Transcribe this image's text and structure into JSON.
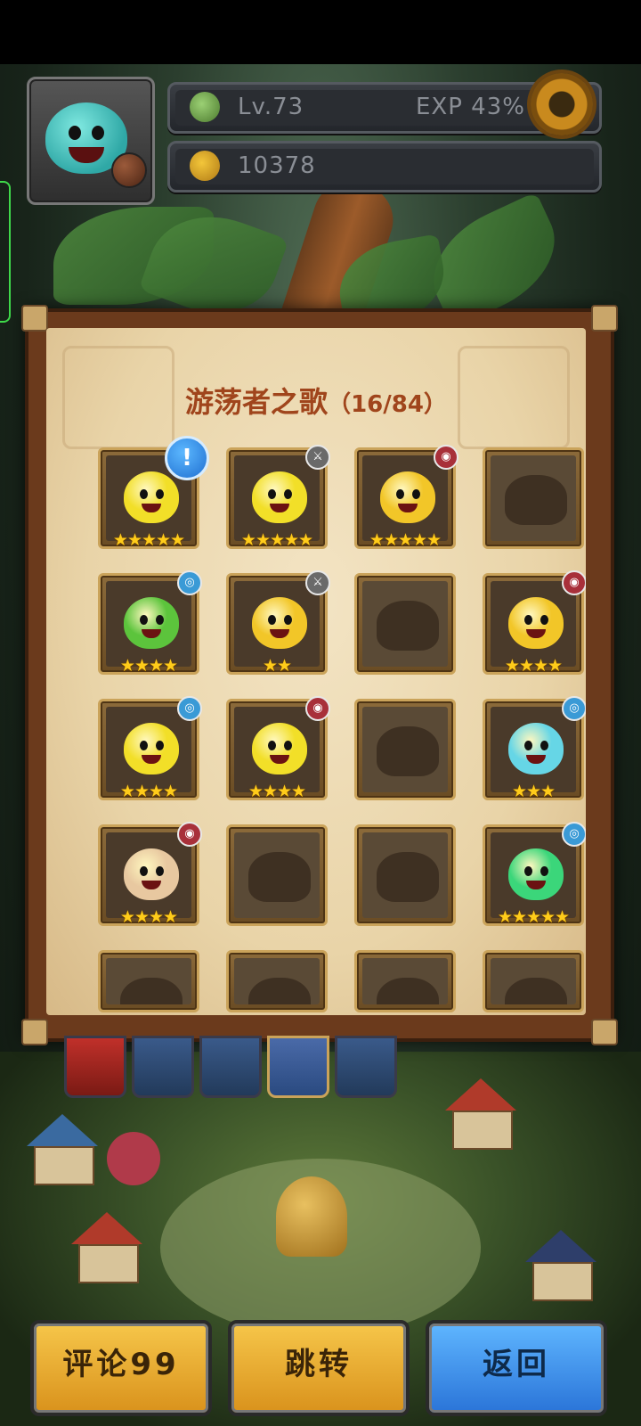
{
  "hud": {
    "level": "Lv.73",
    "exp": "EXP 43%",
    "currency": "10378"
  },
  "panel": {
    "title": "游荡者之歌",
    "progress": "（16/84）",
    "slots": [
      {
        "unlocked": true,
        "stars": "★★★★★",
        "alert": "!",
        "body": "#f2df28",
        "element": ""
      },
      {
        "unlocked": true,
        "stars": "★★★★★",
        "body": "#f2df28",
        "element": "sword"
      },
      {
        "unlocked": true,
        "stars": "★★★★★",
        "body": "#f2c628",
        "element": "fire"
      },
      {
        "unlocked": false
      },
      {
        "unlocked": true,
        "stars": "★★★★",
        "body": "#5cc43c",
        "element": "water"
      },
      {
        "unlocked": true,
        "stars": "★★",
        "body": "#f2c628",
        "element": "sword"
      },
      {
        "unlocked": false
      },
      {
        "unlocked": true,
        "stars": "★★★★",
        "body": "#f2c628",
        "element": "fire"
      },
      {
        "unlocked": true,
        "stars": "★★★★",
        "body": "#f2df28",
        "element": "water"
      },
      {
        "unlocked": true,
        "stars": "★★★★",
        "body": "#f2df28",
        "element": "fire"
      },
      {
        "unlocked": false
      },
      {
        "unlocked": true,
        "stars": "★★★",
        "body": "#66d6e6",
        "element": "water"
      },
      {
        "unlocked": true,
        "stars": "★★★★",
        "body": "#e8c8a0",
        "element": "fire"
      },
      {
        "unlocked": false
      },
      {
        "unlocked": false
      },
      {
        "unlocked": true,
        "stars": "★★★★★",
        "body": "#3bd67a",
        "element": "water"
      },
      {
        "unlocked": false
      },
      {
        "unlocked": false
      },
      {
        "unlocked": false
      },
      {
        "unlocked": false
      }
    ]
  },
  "buttons": {
    "comment": "评论99",
    "jump": "跳转",
    "back": "返回"
  },
  "colors": {
    "title": "#a0451c",
    "star": "#ffcc1a",
    "gold_button": "#f6c64a",
    "blue_button": "#5fb6ff"
  }
}
